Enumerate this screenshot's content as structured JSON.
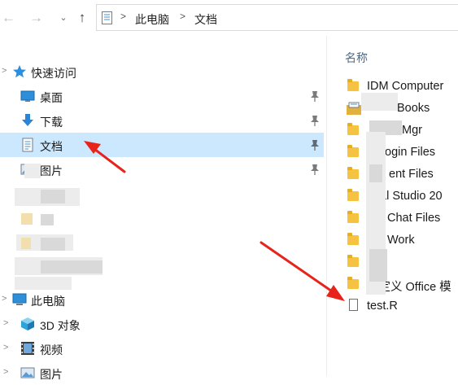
{
  "toolbar": {
    "back_icon": "arrow-left-icon",
    "forward_icon": "arrow-right-icon",
    "recent_icon": "chevron-down-icon",
    "up_icon": "arrow-up-icon",
    "up_glyph": "↑"
  },
  "address_bar": {
    "breadcrumbs": [
      "此电脑",
      "文档"
    ],
    "separator": ">"
  },
  "nav": {
    "quick_access": {
      "label": "快速访问",
      "expander": ">"
    },
    "items": [
      {
        "label": "桌面",
        "icon": "desktop-icon"
      },
      {
        "label": "下载",
        "icon": "download-arrow-icon"
      },
      {
        "label": "文档",
        "icon": "document-icon"
      },
      {
        "label": "图片",
        "icon": "picture-icon"
      }
    ],
    "this_pc": {
      "label": "此电脑",
      "expander": ">"
    },
    "pc_items": [
      {
        "label": "3D 对象",
        "icon": "cube-3d-icon"
      },
      {
        "label": "视频",
        "icon": "film-icon"
      },
      {
        "label": "图片",
        "icon": "picture-icon"
      }
    ]
  },
  "file_list": {
    "column_name": "名称",
    "rows": [
      {
        "label": "IDM Computer",
        "type": "folder"
      },
      {
        "label": "Books",
        "type": "library"
      },
      {
        "label": "Mgr",
        "type": "folder"
      },
      {
        "label": "ogin Files",
        "type": "folder"
      },
      {
        "label": "ent Files",
        "type": "folder"
      },
      {
        "label": "al Studio 20",
        "type": "folder"
      },
      {
        "label": "Chat Files",
        "type": "folder"
      },
      {
        "label": "Work",
        "type": "folder"
      },
      {
        "label": "",
        "type": "folder"
      },
      {
        "label": "自定义 Office 模",
        "type": "folder"
      },
      {
        "label": "test.R",
        "type": "file"
      }
    ]
  },
  "colors": {
    "selected_bg": "#cce8ff",
    "folder": "#f5c341",
    "arrow": "#e8231b",
    "header_text": "#4d6a87"
  }
}
